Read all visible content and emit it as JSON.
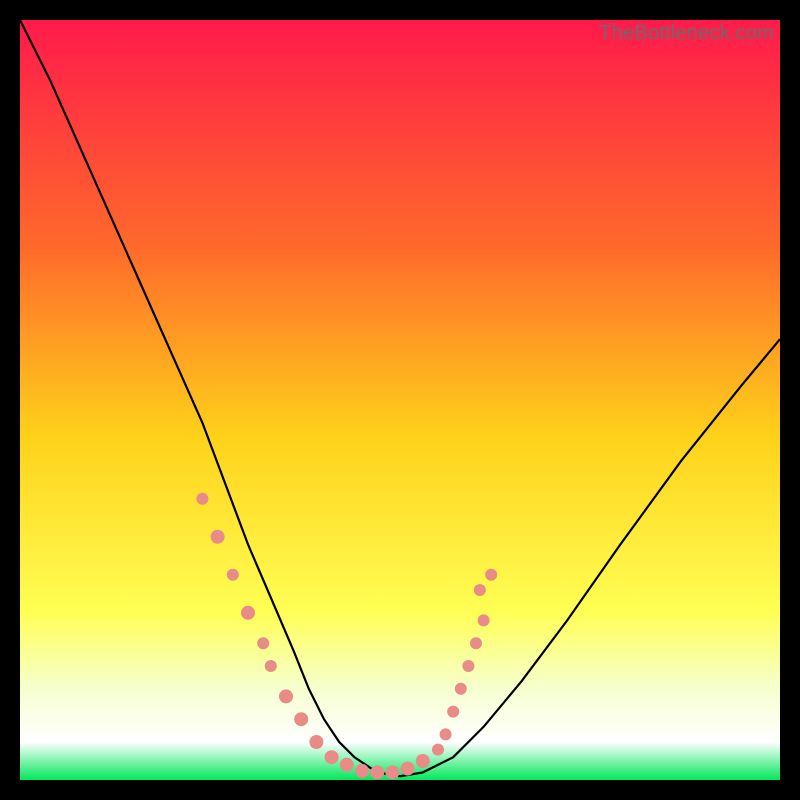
{
  "watermark": "TheBottleneck.com",
  "chart_data": {
    "type": "line",
    "title": "",
    "xlabel": "",
    "ylabel": "",
    "xlim": [
      0,
      100
    ],
    "ylim": [
      0,
      100
    ],
    "gradient_stops": [
      {
        "offset": 0,
        "color": "#ff1a4b"
      },
      {
        "offset": 30,
        "color": "#ff6a2b"
      },
      {
        "offset": 55,
        "color": "#ffd21a"
      },
      {
        "offset": 78,
        "color": "#ffff55"
      },
      {
        "offset": 88,
        "color": "#f6ffcf"
      },
      {
        "offset": 95,
        "color": "#ffffff"
      },
      {
        "offset": 100,
        "color": "#00e85a"
      }
    ],
    "series": [
      {
        "name": "bottleneck-curve",
        "x": [
          0,
          4,
          8,
          12,
          16,
          20,
          24,
          27,
          30,
          33,
          36,
          38,
          40,
          42,
          44,
          47,
          50,
          53,
          57,
          61,
          66,
          72,
          79,
          87,
          95,
          100
        ],
        "y": [
          100,
          92,
          83,
          74,
          65,
          56,
          47,
          39,
          31,
          24,
          17,
          12,
          8,
          5,
          3,
          1,
          0.5,
          1,
          3,
          7,
          13,
          21,
          31,
          42,
          52,
          58
        ]
      }
    ],
    "markers": {
      "name": "highlight-points",
      "color": "#e98b87",
      "points": [
        {
          "x": 24,
          "y": 37,
          "r": 6
        },
        {
          "x": 26,
          "y": 32,
          "r": 7
        },
        {
          "x": 28,
          "y": 27,
          "r": 6
        },
        {
          "x": 30,
          "y": 22,
          "r": 7
        },
        {
          "x": 32,
          "y": 18,
          "r": 6
        },
        {
          "x": 33,
          "y": 15,
          "r": 6
        },
        {
          "x": 35,
          "y": 11,
          "r": 7
        },
        {
          "x": 37,
          "y": 8,
          "r": 7
        },
        {
          "x": 39,
          "y": 5,
          "r": 7
        },
        {
          "x": 41,
          "y": 3,
          "r": 7
        },
        {
          "x": 43,
          "y": 2,
          "r": 7
        },
        {
          "x": 45,
          "y": 1.2,
          "r": 7
        },
        {
          "x": 47,
          "y": 1,
          "r": 7
        },
        {
          "x": 49,
          "y": 1,
          "r": 7
        },
        {
          "x": 51,
          "y": 1.5,
          "r": 7
        },
        {
          "x": 53,
          "y": 2.5,
          "r": 7
        },
        {
          "x": 55,
          "y": 4,
          "r": 6
        },
        {
          "x": 56,
          "y": 6,
          "r": 6
        },
        {
          "x": 57,
          "y": 9,
          "r": 6
        },
        {
          "x": 58,
          "y": 12,
          "r": 6
        },
        {
          "x": 59,
          "y": 15,
          "r": 6
        },
        {
          "x": 60,
          "y": 18,
          "r": 6
        },
        {
          "x": 61,
          "y": 21,
          "r": 6
        },
        {
          "x": 60.5,
          "y": 25,
          "r": 6
        },
        {
          "x": 62,
          "y": 27,
          "r": 6
        }
      ]
    }
  }
}
